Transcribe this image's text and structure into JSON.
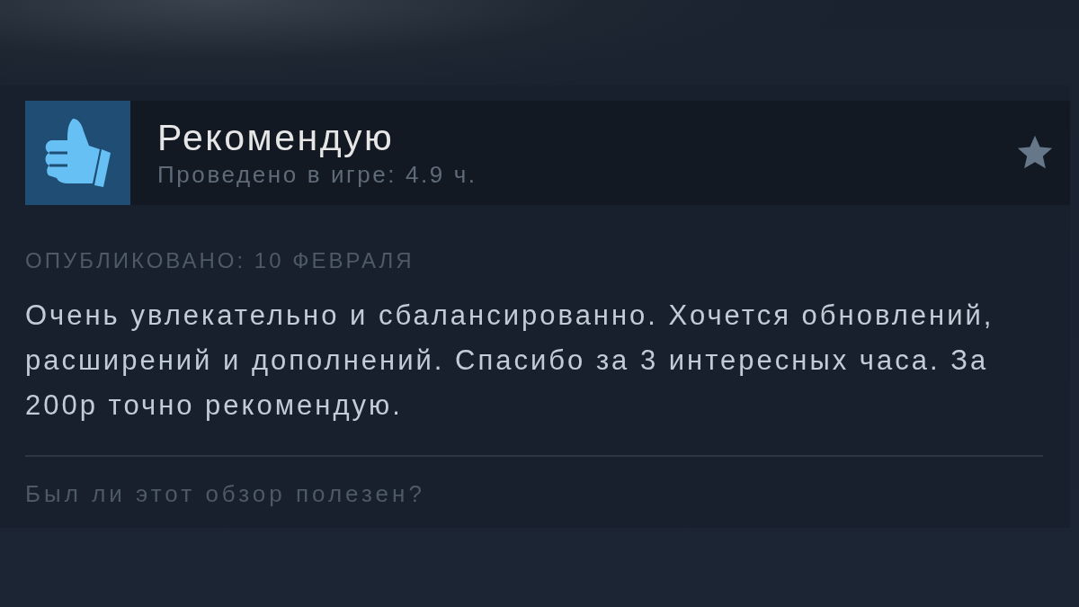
{
  "review": {
    "verdict": {
      "kind": "recommended",
      "label": "Рекомендую"
    },
    "playtime": "Проведено в игре: 4.9 ч.",
    "posted": "ОПУБЛИКОВАНО: 10 ФЕВРАЛЯ",
    "text": "Очень увлекательно и сбалансированно. Хочется обновлений, расширений и дополнений. Спасибо за 3 интересных часа. За 200р точно рекомендую.",
    "helpful_prompt": "Был ли этот обзор полезен?"
  }
}
